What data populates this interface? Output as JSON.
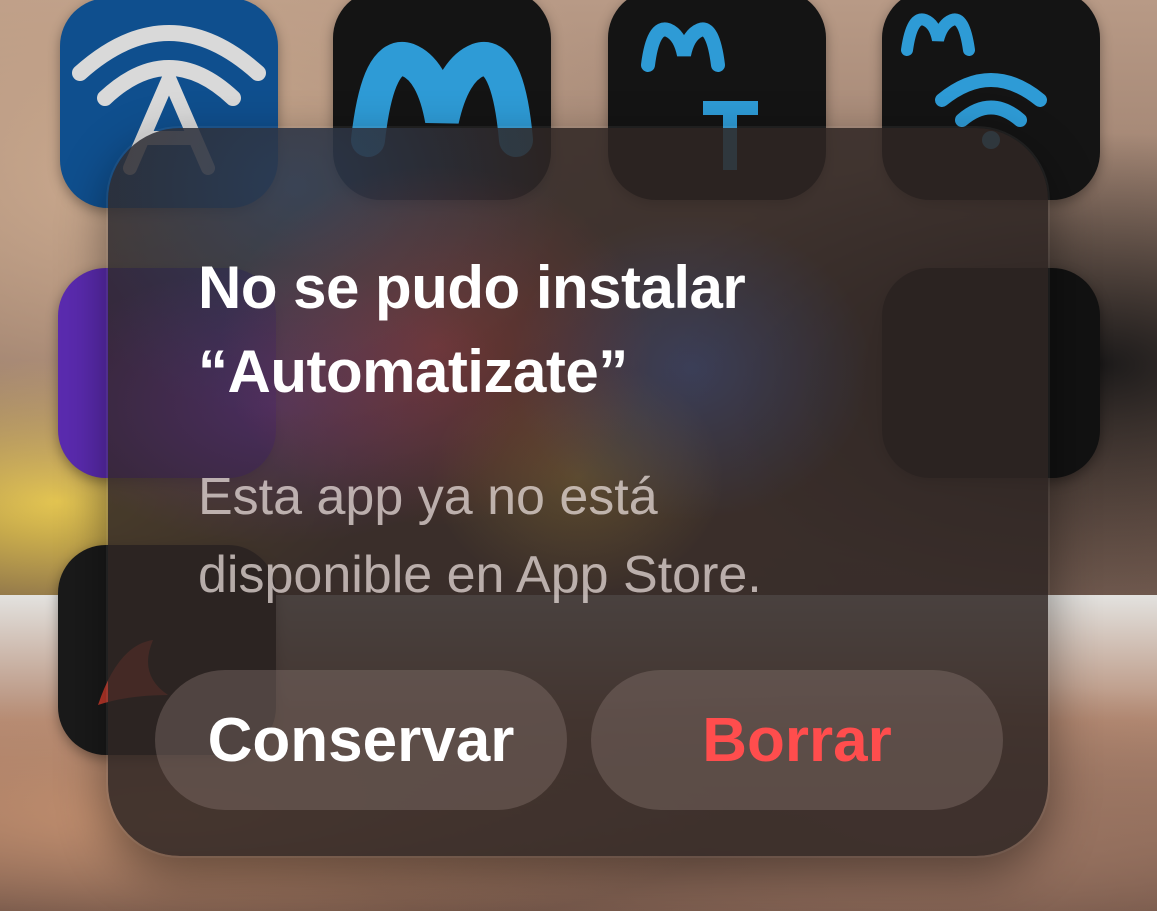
{
  "alert": {
    "title_line1": "No se pudo instalar",
    "title_line2": "“Automatizate”",
    "message_line1": "Esta app ya no está",
    "message_line2": "disponible en App Store.",
    "buttons": {
      "keep_label": "Conservar",
      "delete_label": "Borrar"
    },
    "colors": {
      "destructive": "#ff4d4d",
      "primary_text": "#ffffff"
    }
  },
  "home_screen": {
    "icons": [
      {
        "name": "wifi-antenna-app-icon"
      },
      {
        "name": "movistar-app-icon"
      },
      {
        "name": "movistar-tv-app-icon"
      },
      {
        "name": "movistar-smart-wifi-app-icon"
      },
      {
        "name": "purple-app-icon"
      },
      {
        "name": "dark-app-icon"
      },
      {
        "name": "red-bird-app-icon"
      }
    ]
  }
}
